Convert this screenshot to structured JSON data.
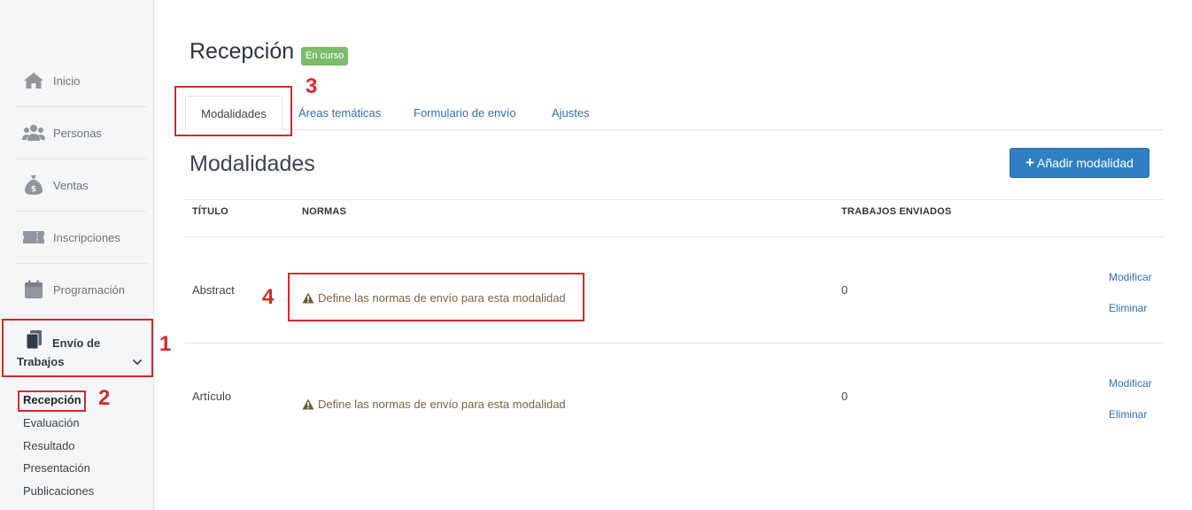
{
  "sidebar": {
    "items": [
      {
        "label": "Inicio",
        "icon": "home-icon"
      },
      {
        "label": "Personas",
        "icon": "users-icon"
      },
      {
        "label": "Ventas",
        "icon": "money-bag-icon"
      },
      {
        "label": "Inscripciones",
        "icon": "ticket-icon"
      },
      {
        "label": "Programación",
        "icon": "calendar-icon"
      }
    ],
    "active_item": {
      "label_line1": "Envío de",
      "label_line2": "Trabajos",
      "icon": "documents-icon"
    },
    "sub_items": [
      {
        "label": "Recepción"
      },
      {
        "label": "Evaluación"
      },
      {
        "label": "Resultado"
      },
      {
        "label": "Presentación"
      },
      {
        "label": "Publicaciones"
      }
    ]
  },
  "header": {
    "title": "Recepción",
    "badge": "En curso"
  },
  "tabs": [
    {
      "label": "Modalidades"
    },
    {
      "label": "Áreas temáticas"
    },
    {
      "label": "Formulario de envío"
    },
    {
      "label": "Ajustes"
    }
  ],
  "section": {
    "title": "Modalidades",
    "add_button": "Añadir modalidad"
  },
  "table": {
    "headers": {
      "title": "TÍTULO",
      "rules": "NORMAS",
      "submissions": "TRABAJOS ENVIADOS"
    },
    "rows": [
      {
        "title": "Abstract",
        "rules": "Define las normas de envío para esta modalidad",
        "submissions": "0",
        "edit": "Modificar",
        "delete": "Eliminar"
      },
      {
        "title": "Artículo",
        "rules": "Define las normas de envío para esta modalidad",
        "submissions": "0",
        "edit": "Modificar",
        "delete": "Eliminar"
      }
    ]
  },
  "annotations": [
    "1",
    "2",
    "3",
    "4"
  ],
  "colors": {
    "accent": "#2f7fc2",
    "badge": "#7bbd6c",
    "annotation": "#d42a2a",
    "link": "#2f6fb3"
  }
}
